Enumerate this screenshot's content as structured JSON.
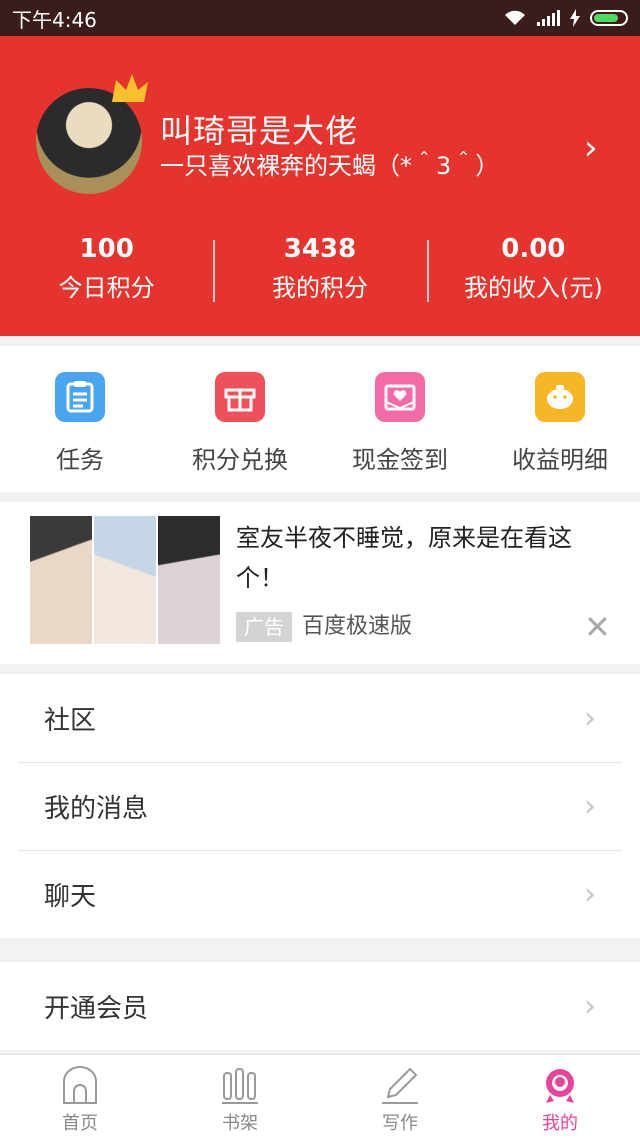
{
  "status": {
    "time": "下午4:46"
  },
  "profile": {
    "name": "叫琦哥是大佬",
    "bio": "一只喜欢裸奔的天蝎（*＾3＾）"
  },
  "stats": [
    {
      "value": "100",
      "label": "今日积分"
    },
    {
      "value": "3438",
      "label": "我的积分"
    },
    {
      "value": "0.00",
      "label": "我的收入(元)"
    }
  ],
  "quick_actions": [
    {
      "label": "任务",
      "icon": "task-list-icon",
      "color": "#4aa4f0"
    },
    {
      "label": "积分兑换",
      "icon": "gift-icon",
      "color": "#f0505a"
    },
    {
      "label": "现金签到",
      "icon": "envelope-heart-icon",
      "color": "#f46aa4"
    },
    {
      "label": "收益明细",
      "icon": "piggy-bank-icon",
      "color": "#f6b727"
    }
  ],
  "ad": {
    "title": "室友半夜不睡觉，原来是在看这个！",
    "badge": "广告",
    "source": "百度极速版"
  },
  "menu_group1": [
    "社区",
    "我的消息",
    "聊天"
  ],
  "menu_group2": [
    "开通会员"
  ],
  "tabs": [
    {
      "label": "首页",
      "icon": "home-icon"
    },
    {
      "label": "书架",
      "icon": "bookshelf-icon"
    },
    {
      "label": "写作",
      "icon": "pencil-icon"
    },
    {
      "label": "我的",
      "icon": "profile-icon"
    }
  ],
  "colors": {
    "brand_red": "#e5342d",
    "active_pink": "#e8459a"
  }
}
